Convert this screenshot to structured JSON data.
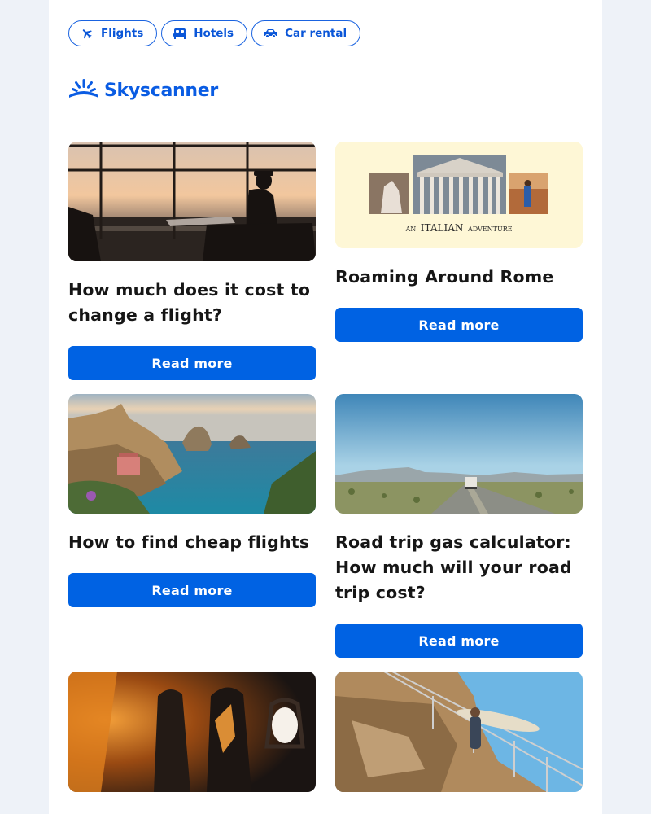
{
  "nav": {
    "pills": [
      {
        "label": "Flights",
        "icon": "plane-icon"
      },
      {
        "label": "Hotels",
        "icon": "bed-icon"
      },
      {
        "label": "Car rental",
        "icon": "car-icon"
      }
    ]
  },
  "brand": {
    "name": "Skyscanner",
    "color": "#0062e3"
  },
  "articles": [
    {
      "title": "How much does it cost to change a flight?",
      "cta": "Read more",
      "image": "airport-window-photo"
    },
    {
      "title": "Roaming Around Rome",
      "cta": "Read more",
      "image": "rome-collage-photo",
      "image_caption": [
        "AN",
        "ITALIAN",
        "ADVENTURE"
      ]
    },
    {
      "title": "How to find cheap flights",
      "cta": "Read more",
      "image": "coastline-photo"
    },
    {
      "title": "Road trip gas calculator: How much will your road trip cost?",
      "cta": "Read more",
      "image": "desert-road-photo"
    },
    {
      "title": "",
      "cta": "",
      "image": "airplane-cabin-photo"
    },
    {
      "title": "",
      "cta": "",
      "image": "cliff-surfer-photo"
    }
  ],
  "colors": {
    "button": "#0062e3",
    "page_bg": "#eef2f8",
    "card_bg": "#ffffff",
    "heading": "#161616"
  }
}
